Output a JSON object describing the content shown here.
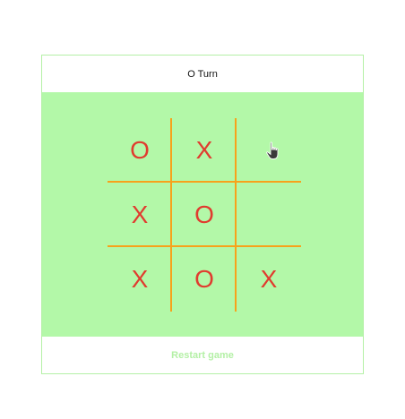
{
  "status": {
    "text": "O Turn"
  },
  "board": {
    "cells": [
      "O",
      "X",
      "",
      "X",
      "O",
      "",
      "X",
      "O",
      "X"
    ]
  },
  "restart": {
    "label": "Restart game"
  },
  "colors": {
    "board_background": "#b3f8a8",
    "grid_lines": "#f7a21b",
    "marks": "#e03c2f",
    "restart_text": "#b4f0a6"
  },
  "icons": {
    "cursor": "hand-pointer-icon"
  }
}
